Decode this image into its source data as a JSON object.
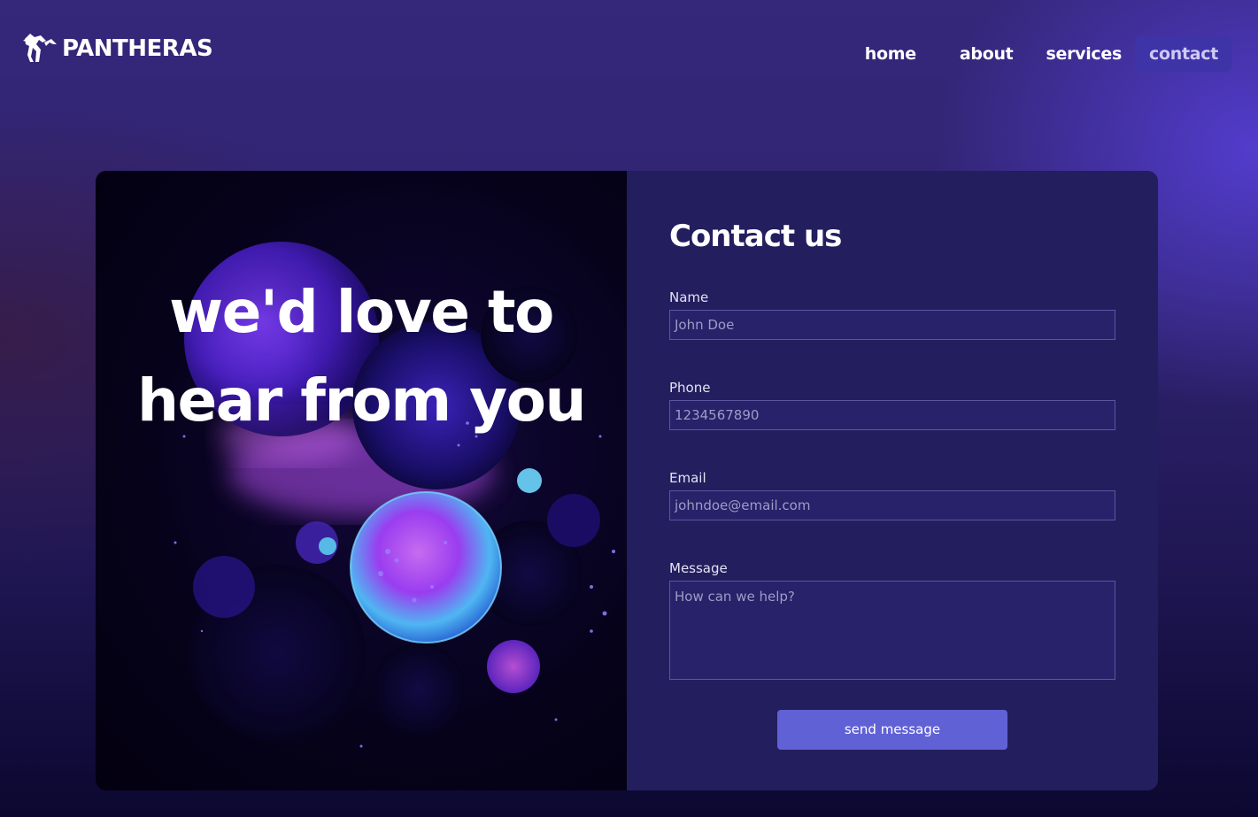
{
  "brand": {
    "name": "PANTHERAS",
    "logo_icon": "panther-icon"
  },
  "nav": {
    "items": [
      {
        "label": "home",
        "active": false
      },
      {
        "label": "about",
        "active": false
      },
      {
        "label": "services",
        "active": false
      },
      {
        "label": "contact",
        "active": true
      }
    ]
  },
  "hero": {
    "line1": "we'd love to",
    "line2": "hear from you"
  },
  "form": {
    "title": "Contact us",
    "fields": {
      "name": {
        "label": "Name",
        "placeholder": "John Doe"
      },
      "phone": {
        "label": "Phone",
        "placeholder": "1234567890"
      },
      "email": {
        "label": "Email",
        "placeholder": "johndoe@email.com"
      },
      "message": {
        "label": "Message",
        "placeholder": "How can we help?"
      }
    },
    "submit_label": "send message"
  },
  "colors": {
    "background_top": "#35277a",
    "background_bottom": "#0b0830",
    "card_panel": "#231e5e",
    "button": "#6161d6",
    "nav_active_bg": "#3f33a8"
  }
}
